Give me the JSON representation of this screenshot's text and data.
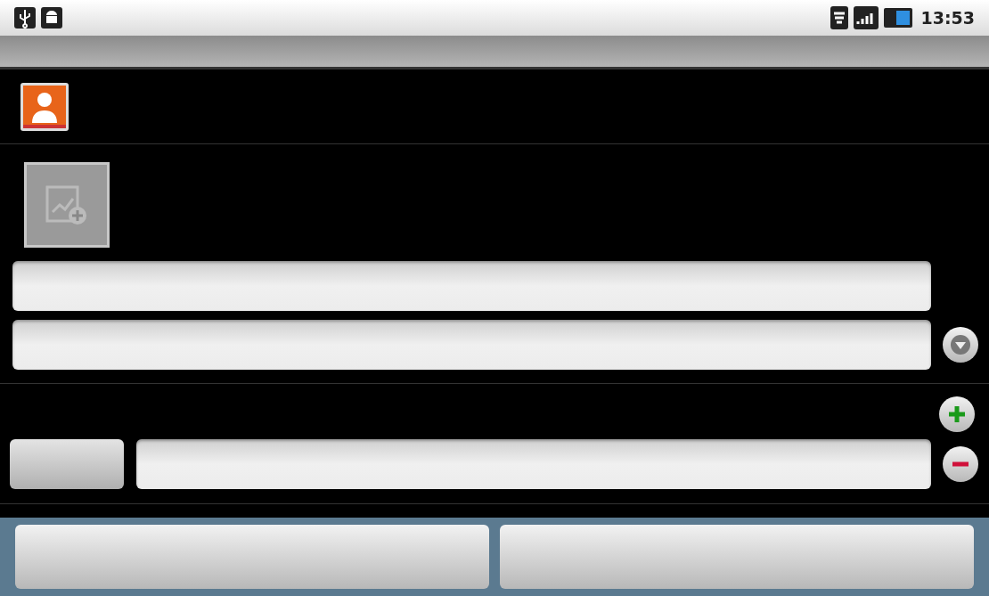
{
  "status_bar": {
    "time": "13:53"
  }
}
